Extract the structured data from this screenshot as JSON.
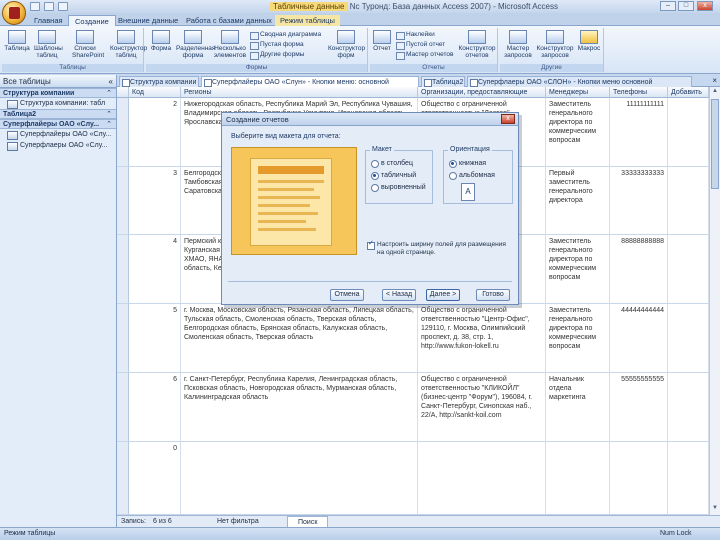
{
  "window": {
    "title": "Table Tools Вд ... Туроа : База данных Access 2007) - Microsoft Access",
    "title_context": "Табличные данные",
    "title_main": "Nc Туронд: База данных Access 2007) - Microsoft Access",
    "minimize": "–",
    "maximize": "□",
    "close": "x"
  },
  "ribbon_tabs": [
    {
      "label": "Главная"
    },
    {
      "label": "Создание"
    },
    {
      "label": "Внешние данные"
    },
    {
      "label": "Работа с базами данных"
    },
    {
      "label": "Режим таблицы"
    }
  ],
  "ribbon": {
    "groups": [
      {
        "label": "Таблицы",
        "buttons": [
          "Таблица",
          "Шаблоны таблиц",
          "Списки SharePoint",
          "Конструктор таблиц"
        ]
      },
      {
        "label": "Формы",
        "buttons": [
          "Форма",
          "Разделенная форма",
          "Несколько элементов"
        ],
        "small": [
          "Сводная диаграмма",
          "Пустая форма",
          "Другие формы"
        ],
        "extra": "Конструктор форм"
      },
      {
        "label": "Отчеты",
        "buttons": [
          "Отчет"
        ],
        "small": [
          "Наклейки",
          "Пустой отчет",
          "Мастер отчетов"
        ],
        "extra": "Конструктор отчетов"
      },
      {
        "label": "Другие",
        "buttons": [
          "Мастер запросов",
          "Конструктор запросов",
          "Макрос"
        ]
      }
    ]
  },
  "nav": {
    "header": "Все таблицы",
    "header_chevron": "«",
    "sections": [
      {
        "title": "Структура компании",
        "items": [
          "Структура компании: табл"
        ]
      },
      {
        "title": "Таблица2",
        "items": []
      },
      {
        "title": "Суперфлайеры ОАО «Слу...",
        "items": [
          "Суперфлайеры ОАО «Слу...",
          "Суперфлаеры ОАО «Слу..."
        ]
      }
    ],
    "chevron": "⌃"
  },
  "doc_tabs": [
    {
      "label": "Структура компании"
    },
    {
      "label": "Суперфлайеры ОАО «Слун» - Кнопки меню: основной"
    },
    {
      "label": "Таблица2"
    },
    {
      "label": "Суперфлаеры ОАО «СЛОН» - Кнопки меню основной"
    }
  ],
  "sheet": {
    "columns": [
      "Код",
      "Регионы",
      "Организации, предоставляющие",
      "Менеджеры",
      "Телефоны",
      "Добавить"
    ],
    "rows": [
      {
        "id": "2",
        "region": "Нижегородская область, Республика Марий Эл, Республика Чувашия, Владимирская область, Республика Удмуртия, Ивановская область, Ярославская область, Кировская область, Костромская область",
        "org": "Общество с ограниченной ответственностью \"Лестор\"",
        "manager": "Заместитель генерального директора по коммерческим вопросам",
        "phone": "11111111111"
      },
      {
        "id": "3",
        "region": "Белгородская область, Воронежская область, Курская область, Тамбовская область, Орловская область, Липецкая область, Саратовская область, Пензенская область",
        "org": "Общество с ограниченной ответственностью",
        "manager": "Первый заместитель генерального директора",
        "phone": "33333333333"
      },
      {
        "id": "4",
        "region": "Пермский край, Свердловская область, Челябинская область, Курганская область, Республика Башкортостан, Тюменская область, ХМАО, ЯНАО, Томская область, Новосибирская область, Омская область, Кемеровская область",
        "org": "Общество с ограниченной ответственностью, улица, 77",
        "manager": "Заместитель генерального директора по коммерческим вопросам",
        "phone": "88888888888"
      },
      {
        "id": "5",
        "region": "г. Москва, Московская область, Рязанская область, Липецкая область, Тульская область, Смоленская область, Тверская область, Белгородская область, Брянская область, Калужская область, Смоленская область, Тверская область",
        "org": "Общество с ограниченной ответственностью \"Центр-Офис\", 129110, г. Москва, Олимпийский проспект, д. 38, стр. 1, http://www.fukon-lokell.ru",
        "manager": "Заместитель генерального директора по коммерческим вопросам",
        "phone": "44444444444"
      },
      {
        "id": "6",
        "region": "г. Санкт-Петербург, Республика Карелия, Ленинградская область, Псковская область, Новгородская область, Мурманская область, Калининградская область",
        "org": "Общество с ограниченной ответственностью \"КЛИКОЙЛ\" (бизнес-центр \"Форум\"), 196084, г. Санкт-Петербург, Синопская наб., 22/А, http://sankt-koil.com",
        "manager": "Начальник отдела маркетинга",
        "phone": "55555555555"
      },
      {
        "id": "0",
        "region": "",
        "org": "",
        "manager": "",
        "phone": ""
      }
    ]
  },
  "record_nav": {
    "label": "Запись: ",
    "position": "6 из 6",
    "filter": "Нет фильтра",
    "search": "Поиск"
  },
  "status": {
    "left": "Режим таблицы",
    "right": "Num Lock"
  },
  "dialog": {
    "title": "Создание отчетов",
    "question": "Выберите вид макета для отчета:",
    "layout_legend": "Макет",
    "layout_options": [
      {
        "label": "в столбец",
        "on": false
      },
      {
        "label": "табличный",
        "on": true
      },
      {
        "label": "выровненный",
        "on": false
      }
    ],
    "orientation_legend": "Ориентация",
    "orientation_options": [
      {
        "label": "книжная",
        "on": true
      },
      {
        "label": "альбомная",
        "on": false
      }
    ],
    "orientation_icon": "A",
    "check_label": "Настроить ширину полей для размещения на одной странице.",
    "buttons": {
      "cancel": "Отмена",
      "back": "< Назад",
      "next": "Далее >",
      "finish": "Готово"
    }
  }
}
